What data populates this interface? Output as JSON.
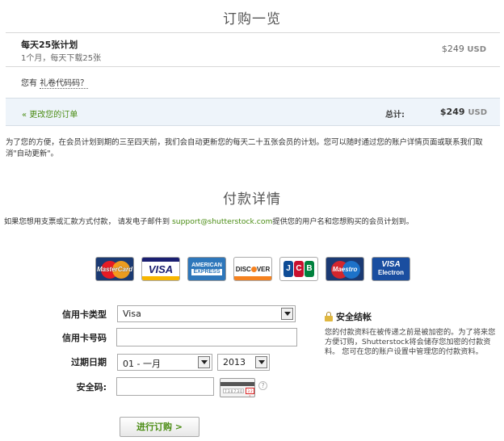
{
  "order_summary": {
    "title": "订购一览",
    "plan_name": "每天25张计划",
    "plan_desc": "1个月，每天下载25张",
    "plan_price": "$249",
    "currency": "USD",
    "gift_prefix": "您有",
    "gift_link": "礼卷代码码？",
    "change_link": "« 更改您的订单",
    "total_label": "总计:",
    "total_price": "$249",
    "total_currency": "USD",
    "renew_note": "为了您的方便，在会员计划到期的三至四天前，我们会自动更新您的每天二十五张会员的计划。您可以随时通过您的账户详情页面或联系我们取消\"自动更新\"。"
  },
  "payment": {
    "title": "付款详情",
    "note_prefix": "如果您想用支票或汇款方式付款， 请发电子邮件到",
    "email": "support@shutterstock.com",
    "note_suffix": "提供您的用户名和您想购买的会员计划到。",
    "cards": [
      {
        "name": "MasterCard",
        "icon": "mastercard-icon"
      },
      {
        "name": "VISA",
        "icon": "visa-icon"
      },
      {
        "name": "AMERICAN EXPRESS",
        "icon": "amex-icon"
      },
      {
        "name": "DISCOVER",
        "icon": "discover-icon"
      },
      {
        "name": "JCB",
        "icon": "jcb-icon"
      },
      {
        "name": "Maestro",
        "icon": "maestro-icon"
      },
      {
        "name": "VISA Electron",
        "icon": "visa-electron-icon"
      }
    ]
  },
  "form": {
    "card_type_label": "信用卡类型",
    "card_type_value": "Visa",
    "card_number_label": "信用卡号码",
    "expiry_label": "过期日期",
    "expiry_month": "01 - 一月",
    "expiry_year": "2013",
    "cvv_label": "安全码:",
    "submit_label": "进行订购 >"
  },
  "secure": {
    "title": "安全结帐",
    "text": "您的付款资料在被传递之前是被加密的。为了将来您方便订购，Shutterstock将会储存您加密的付款资料。 您可在您的账户设置中管理您的付款资料。"
  },
  "colors": {
    "accent_green": "#4a8c13",
    "summary_bg": "#eef4fa"
  }
}
